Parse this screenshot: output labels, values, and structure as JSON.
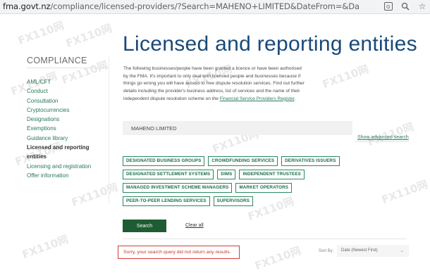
{
  "browser": {
    "url_host": "fma.govt.nz",
    "url_path": "/compliance/licensed-providers/?Search=MAHENO+LIMITED&DateFrom=&DateTo=&Sort=DateTimeSort+DESC&a...",
    "icons": [
      "translate-icon",
      "zoom-icon",
      "star-icon"
    ]
  },
  "watermark": "FX110网",
  "page": {
    "title": "Licensed and reporting entities"
  },
  "sidebar": {
    "heading": "COMPLIANCE",
    "items": [
      {
        "label": "AML/CFT"
      },
      {
        "label": "Conduct"
      },
      {
        "label": "Consultation"
      },
      {
        "label": "Cryptocurrencies"
      },
      {
        "label": "Designations"
      },
      {
        "label": "Exemptions"
      },
      {
        "label": "Guidance library"
      },
      {
        "label": "Licensed and reporting entities",
        "active": true
      },
      {
        "label": "Licensing and registration"
      },
      {
        "label": "Offer information"
      }
    ]
  },
  "intro": {
    "text": "The following businesses/people have been granted a licence or have been authorised by the FMA. It's important to only deal with licensed people and businesses because if things go wrong you will have access to free dispute resolution services. Find out further details including the provider's business address, list of services and the name of their independent dispute resolution scheme on the ",
    "link": "Financial Service Providers Register",
    "suffix": "."
  },
  "search": {
    "value": "MAHENO LIMITED",
    "advanced_link": "Show advanced search"
  },
  "filters": [
    "DESIGNATED BUSINESS GROUPS",
    "CROWDFUNDING SERVICES",
    "DERIVATIVES ISSUERS",
    "DESIGNATED SETTLEMENT SYSTEMS",
    "DIMS",
    "INDEPENDENT TRUSTEES",
    "MANAGED INVESTMENT SCHEME MANAGERS",
    "MARKET OPERATORS",
    "PEER-TO-PEER LENDING SERVICES",
    "SUPERVISORS"
  ],
  "actions": {
    "search_label": "Search",
    "clear_label": "Clear all"
  },
  "results": {
    "message": "Sorry, your search query did not return any results.",
    "sort_label": "Sort By:",
    "sort_value": "Date (Newest First)"
  },
  "colors": {
    "title": "#19497a",
    "link": "#2a7a58",
    "button": "#1e5c33",
    "error": "#d23b3b"
  }
}
